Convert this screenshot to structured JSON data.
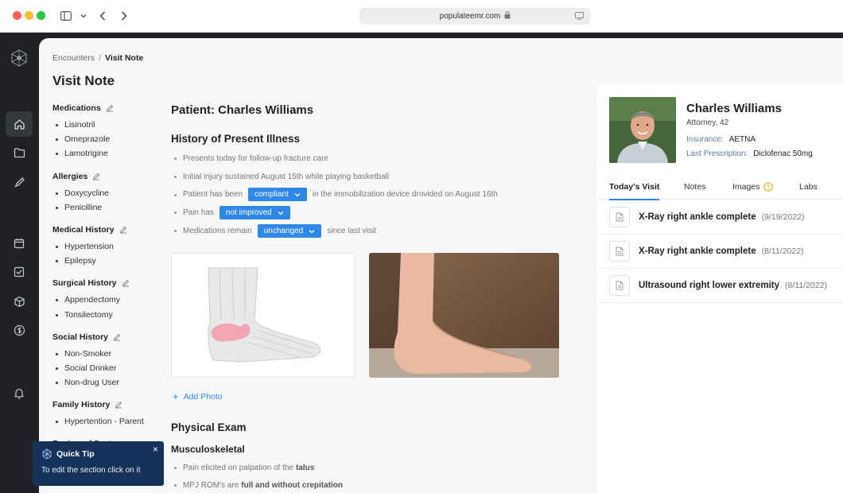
{
  "browser": {
    "url": "populateemr.com"
  },
  "breadcrumb": {
    "root": "Encounters",
    "separator": "/",
    "current": "Visit Note"
  },
  "page": {
    "title": "Visit Note"
  },
  "sections": [
    {
      "title": "Medications",
      "items": [
        "Lisinotril",
        "Omeprazole",
        "Lamotrigine"
      ]
    },
    {
      "title": "Allergies",
      "items": [
        "Doxycycline",
        "Penicilline"
      ]
    },
    {
      "title": "Medical History",
      "items": [
        "Hypertension",
        "Epilepsy"
      ]
    },
    {
      "title": "Surgical History",
      "items": [
        "Appendectomy",
        "Tonsilectomy"
      ]
    },
    {
      "title": "Social History",
      "items": [
        "Non-Smoker",
        "Social Drinker",
        "Non-drug User"
      ]
    },
    {
      "title": "Family History",
      "items": [
        "Hypertention - Parent"
      ]
    },
    {
      "title": "Review of Systems",
      "items": []
    }
  ],
  "note": {
    "patient_heading": "Patient: Charles Williams",
    "hpi_heading": "History of Present Illness",
    "hpi": {
      "line1": "Presents today for follow-up fracture care",
      "line2": "Initial injury sustained August 15th while playing basketball",
      "line3_pre": "Patient has been",
      "line3_pill": "compliant",
      "line3_post": "in the immobilization device drovided on August 16th",
      "line4_pre": "Pain has",
      "line4_pill": "not improved",
      "line5_pre": "Medications remain",
      "line5_pill": "unchanged",
      "line5_post": "since last visit"
    },
    "add_photo": "Add Photo",
    "exam_heading": "Physical Exam",
    "msk_heading": "Musculoskeletal",
    "exam": {
      "line1_pre": "Pain elicited on palpation of the",
      "line1_bold": "talus",
      "line2_pre": "MPJ ROM's are",
      "line2_bold": "full and without crepitation"
    }
  },
  "patient": {
    "name": "Charles Williams",
    "occupation_age": "Attorney, 42",
    "insurance_label": "Insurance:",
    "insurance_value": "AETNA",
    "rx_label": "Last Prescription:",
    "rx_value": "Diclofenac 50mg"
  },
  "tabs": [
    "Today's Visit",
    "Notes",
    "Images",
    "Labs"
  ],
  "visits": [
    {
      "name": "X-Ray right ankle complete",
      "date": "(9/19/2022)"
    },
    {
      "name": "X-Ray right ankle complete",
      "date": "(8/11/2022)"
    },
    {
      "name": "Ultrasound right lower extremity",
      "date": "(8/11/2022)"
    }
  ],
  "quick_tip": {
    "title": "Quick Tip",
    "body": "To edit the section click on it",
    "close": "×"
  },
  "colors": {
    "accent": "#2f87e6",
    "rail": "#1f2124",
    "tip": "#14325a",
    "label": "#5d7a96"
  }
}
